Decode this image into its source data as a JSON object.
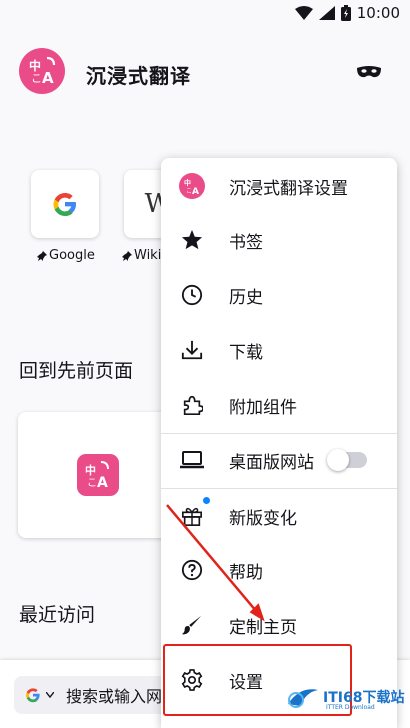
{
  "status_bar": {
    "time": "10:00"
  },
  "header": {
    "app_title": "沉浸式翻译"
  },
  "shortcuts": [
    {
      "label": "Google"
    },
    {
      "label": "Wiki"
    }
  ],
  "sections": {
    "back_to_page": "回到先前页面",
    "recent_visits": "最近访问"
  },
  "toolbar": {
    "search_placeholder": "搜索或输入网"
  },
  "menu": {
    "items": [
      {
        "label": "沉浸式翻译设置",
        "icon": "immersive-translate-icon"
      },
      {
        "label": "书签",
        "icon": "star-icon"
      },
      {
        "label": "历史",
        "icon": "clock-icon"
      },
      {
        "label": "下载",
        "icon": "download-icon"
      },
      {
        "label": "附加组件",
        "icon": "puzzle-icon"
      },
      {
        "label": "桌面版网站",
        "icon": "laptop-icon",
        "toggle": false
      },
      {
        "label": "新版变化",
        "icon": "gift-icon"
      },
      {
        "label": "帮助",
        "icon": "help-icon"
      },
      {
        "label": "定制主页",
        "icon": "paintbrush-icon"
      },
      {
        "label": "设置",
        "icon": "gear-icon"
      }
    ]
  },
  "watermark": {
    "brand": "ITI68下载站",
    "sub": "ITTER Download"
  },
  "colors": {
    "brand_pink": "#ea4c89",
    "highlight_red": "#e2231a",
    "accent_blue": "#0a84ff"
  }
}
